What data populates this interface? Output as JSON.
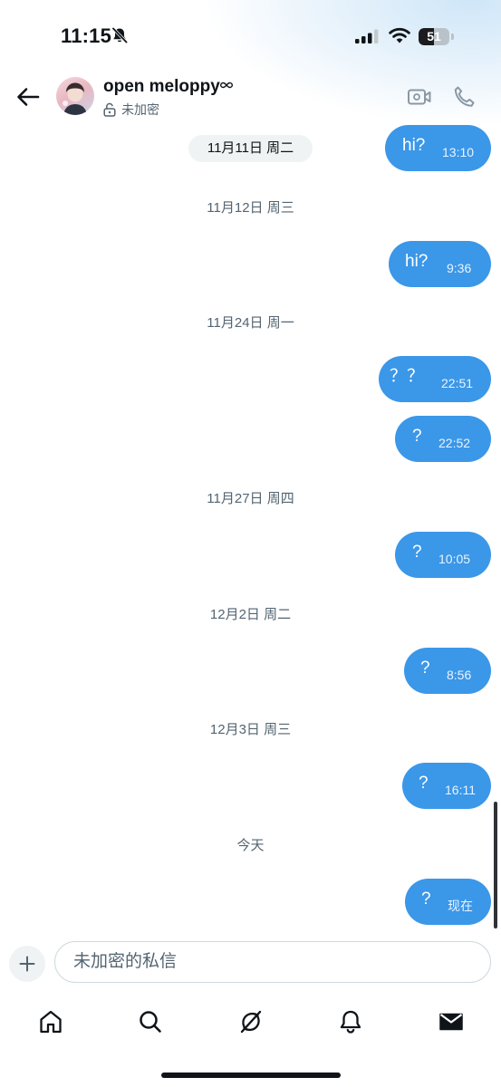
{
  "status_bar": {
    "time": "11:15",
    "battery": "51",
    "battery_level": 0.51
  },
  "header": {
    "contact_name": "open meloppy",
    "encryption_label": "未加密"
  },
  "messages": [
    {
      "date": "11月11日 周二",
      "text": "hi?",
      "time": "13:10"
    },
    {
      "date": "11月12日 周三",
      "text": "hi?",
      "time": "9:36"
    },
    {
      "date": "11月24日 周一",
      "text": "？？",
      "time": "22:51"
    },
    {
      "date": "",
      "text": "?",
      "time": "22:52"
    },
    {
      "date": "11月27日 周四",
      "text": "?",
      "time": "10:05"
    },
    {
      "date": "12月2日 周二",
      "text": "?",
      "time": "8:56"
    },
    {
      "date": "12月3日 周三",
      "text": "?",
      "time": "16:11"
    },
    {
      "date": "今天",
      "text": "?",
      "time": "现在"
    }
  ],
  "composer": {
    "placeholder": "未加密的私信"
  },
  "tabbar": {
    "icons": [
      "home-icon",
      "search-icon",
      "grok-icon",
      "notifications-icon",
      "messages-icon"
    ],
    "active": "messages-icon"
  },
  "colors": {
    "bubble": "#3b97e8",
    "muted_text": "#536471",
    "text": "#0f1419"
  }
}
